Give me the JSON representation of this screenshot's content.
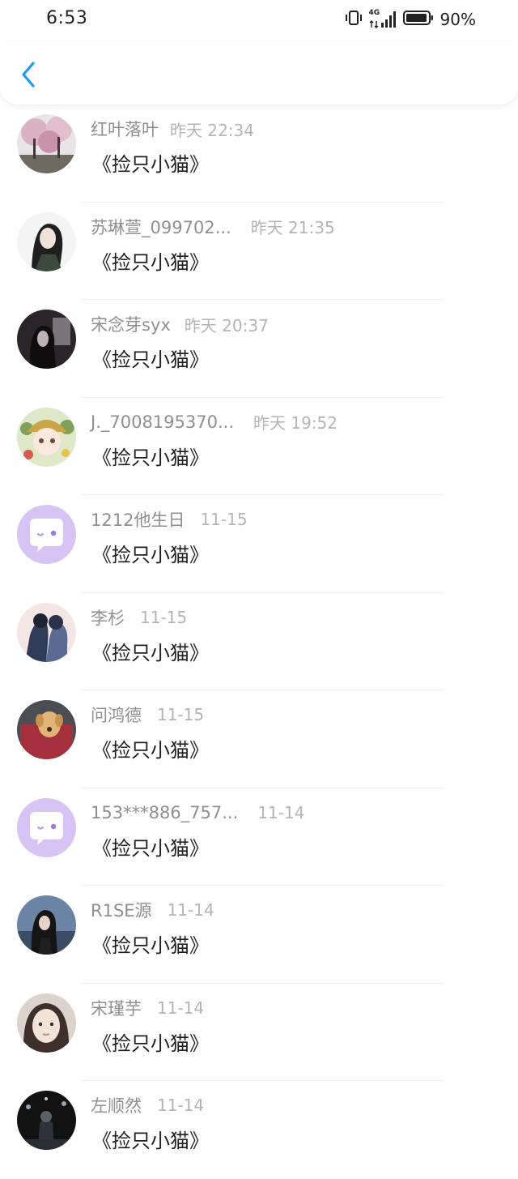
{
  "status_bar": {
    "time": "6:53",
    "network": "4G",
    "battery": "90%"
  },
  "header": {
    "back_icon": "chevron-left-icon",
    "accent_color": "#1e9bea"
  },
  "messages": [
    {
      "name": "红叶落叶",
      "time": "昨天 22:34",
      "text": "《捡只小猫》",
      "avatar": "cherry-blossom-photo"
    },
    {
      "name": "苏琳萱_099702...",
      "time": "昨天 21:35",
      "text": "《捡只小猫》",
      "avatar": "illustrated-portrait"
    },
    {
      "name": "宋念芽syx",
      "time": "昨天 20:37",
      "text": "《捡只小猫》",
      "avatar": "dark-portrait-photo"
    },
    {
      "name": "J._7008195370...",
      "time": "昨天 19:52",
      "text": "《捡只小猫》",
      "avatar": "anime-girl-flowers"
    },
    {
      "name": "1212他生日",
      "time": "11-15",
      "text": "《捡只小猫》",
      "avatar": "default-chat-bubble"
    },
    {
      "name": "李杉",
      "time": "11-15",
      "text": "《捡只小猫》",
      "avatar": "illustrated-couple"
    },
    {
      "name": "问鸿德",
      "time": "11-15",
      "text": "《捡只小猫》",
      "avatar": "puppy-photo"
    },
    {
      "name": "153***886_757...",
      "time": "11-14",
      "text": "《捡只小猫》",
      "avatar": "default-chat-bubble"
    },
    {
      "name": "R1SE源",
      "time": "11-14",
      "text": "《捡只小猫》",
      "avatar": "portrait-photo"
    },
    {
      "name": "宋瑾芋",
      "time": "11-14",
      "text": "《捡只小猫》",
      "avatar": "selfie-photo"
    },
    {
      "name": "左顺然",
      "time": "11-14",
      "text": "《捡只小猫》",
      "avatar": "concert-photo"
    }
  ]
}
